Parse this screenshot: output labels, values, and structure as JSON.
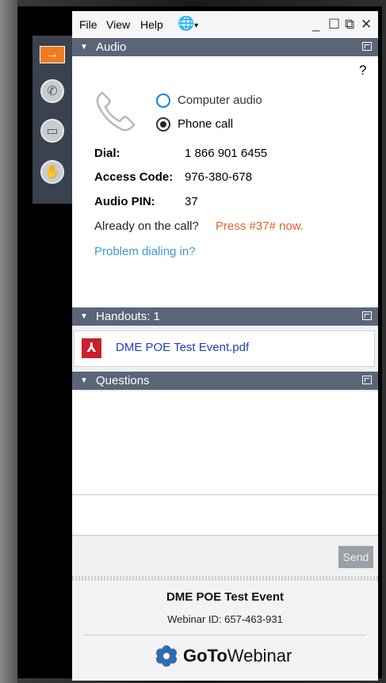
{
  "menu": {
    "file": "File",
    "view": "View",
    "help": "Help"
  },
  "window_controls": {
    "minimize": "_",
    "maximize": "☐",
    "restore": "⧉",
    "close": "✕"
  },
  "audio": {
    "title": "Audio",
    "help": "?",
    "option_computer": "Computer audio",
    "option_phone": "Phone call",
    "dial_label": "Dial:",
    "dial_value": "1 866 901 6455",
    "access_label": "Access Code:",
    "access_value": "976-380-678",
    "pin_label": "Audio PIN:",
    "pin_value": "37",
    "already_text": "Already on the call?",
    "press_text": "Press #37# now.",
    "problem_link": "Problem dialing in?"
  },
  "handouts": {
    "title": "Handouts: 1",
    "file": "DME POE Test Event.pdf"
  },
  "questions": {
    "title": "Questions",
    "send": "Send"
  },
  "footer": {
    "event_title": "DME POE Test Event",
    "webinar_id": "Webinar ID: 657-463-931",
    "brand_goto": "GoTo",
    "brand_webinar": "Webinar"
  },
  "colors": {
    "header": "#5b6578",
    "accent_orange": "#e8612c",
    "link": "#3b9ad9",
    "sidebar_active": "#f07c1f"
  }
}
